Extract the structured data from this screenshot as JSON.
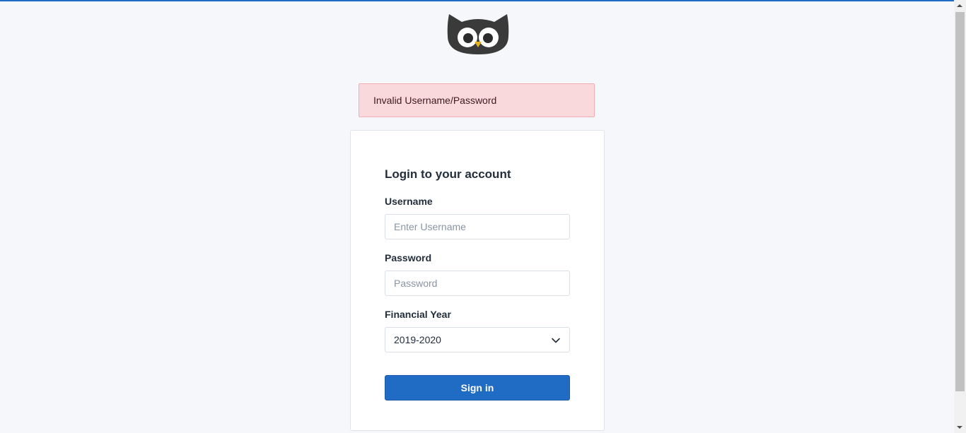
{
  "alert": {
    "message": "Invalid Username/Password"
  },
  "card": {
    "title": "Login to your account",
    "username": {
      "label": "Username",
      "placeholder": "Enter Username",
      "value": ""
    },
    "password": {
      "label": "Password",
      "placeholder": "Password",
      "value": ""
    },
    "financial_year": {
      "label": "Financial Year",
      "selected": "2019-2020"
    },
    "signin_label": "Sign in"
  },
  "colors": {
    "accent": "#206bc4",
    "alert_bg": "#fad9dd",
    "page_bg": "#f5f7fb"
  },
  "icons": {
    "logo": "owl-logo-icon",
    "select": "chevron-down-icon"
  }
}
